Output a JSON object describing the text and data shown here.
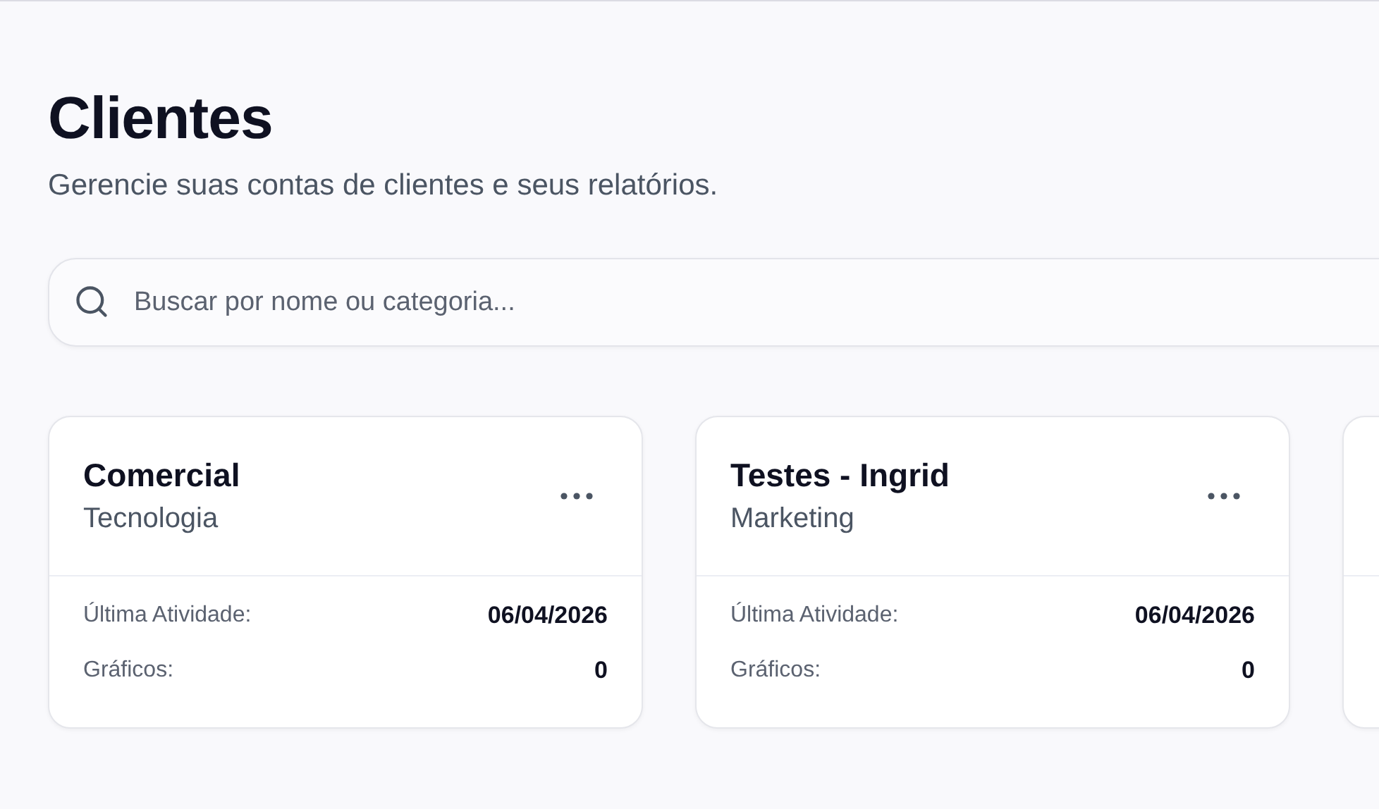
{
  "header": {
    "title": "Clientes",
    "subtitle": "Gerencie suas contas de clientes e seus relatórios."
  },
  "search": {
    "placeholder": "Buscar por nome ou categoria..."
  },
  "clients": [
    {
      "name": "Comercial",
      "category": "Tecnologia",
      "stats": [
        {
          "label": "Última Atividade:",
          "value": "06/04/2026"
        },
        {
          "label": "Gráficos:",
          "value": "0"
        }
      ]
    },
    {
      "name": "Testes - Ingrid",
      "category": "Marketing",
      "stats": [
        {
          "label": "Última Atividade:",
          "value": "06/04/2026"
        },
        {
          "label": "Gráficos:",
          "value": "0"
        }
      ]
    }
  ]
}
